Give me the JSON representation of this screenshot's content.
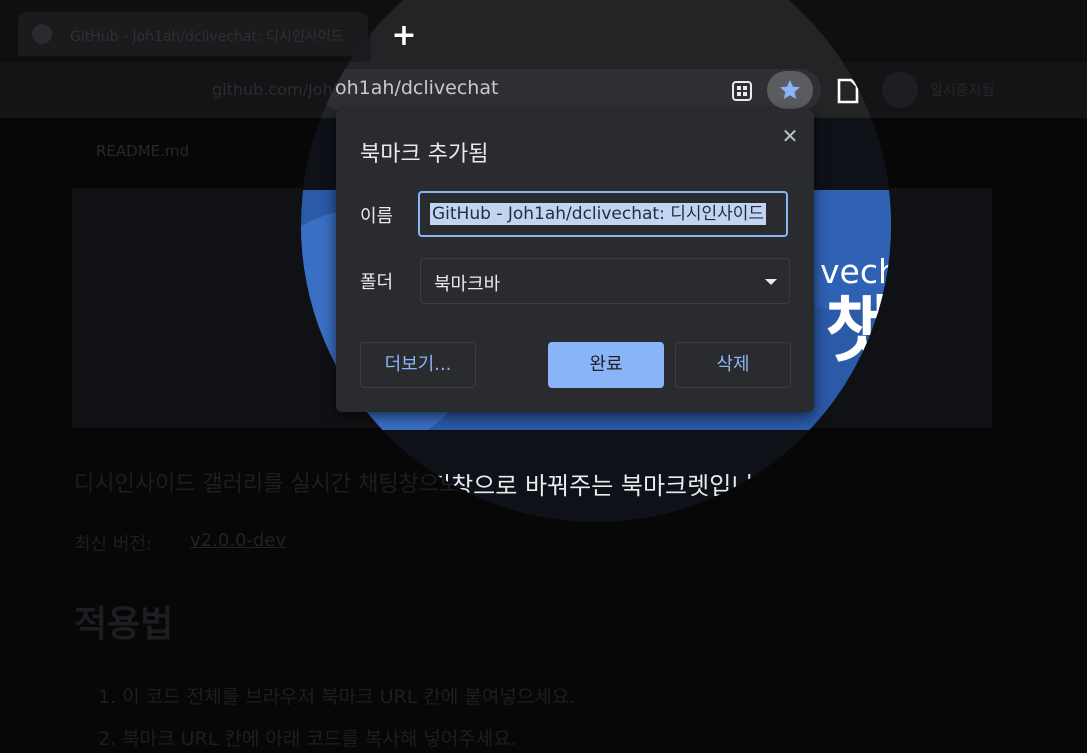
{
  "background": {
    "tab_title": "GitHub - Joh1ah/dclivechat: 디시인사이드",
    "url": "github.com/Joh1ah/dclivechat",
    "profile_label": "일시중지됨",
    "readme_label": "README.md",
    "description_line": "디시인사이드 갤러리를 실시간 채팅창으로 바꿔주는 북마크렛입니다.",
    "version_line": "최신 버전:",
    "version_link": "v2.0.0-dev",
    "usage_heading": "적용법",
    "step1": "1. 이 코드 전체를 브라우저 북마크 URL 칸에 붙여넣으세요.",
    "step2": "2. 북마크 URL 칸에 아래 코드를 복사해 넣어주세요."
  },
  "magnifier": {
    "new_tab_symbol": "+",
    "url_text": "oh1ah/dclivechat",
    "banner_text": "vech",
    "banner_big": "챗",
    "description_text": "팅창으로 바꿔주는 북마크렛입니"
  },
  "dialog": {
    "title": "북마크 추가됨",
    "close_symbol": "✕",
    "name_label": "이름",
    "name_value": "GitHub - Joh1ah/dclivechat: 디시인사이드",
    "folder_label": "폴더",
    "folder_value": "북마크바",
    "more_button": "더보기...",
    "done_button": "완료",
    "remove_button": "삭제"
  },
  "colors": {
    "accent": "#8ab4f8",
    "dialog_bg": "#2a2b2e",
    "star": "#8ab4f8"
  }
}
